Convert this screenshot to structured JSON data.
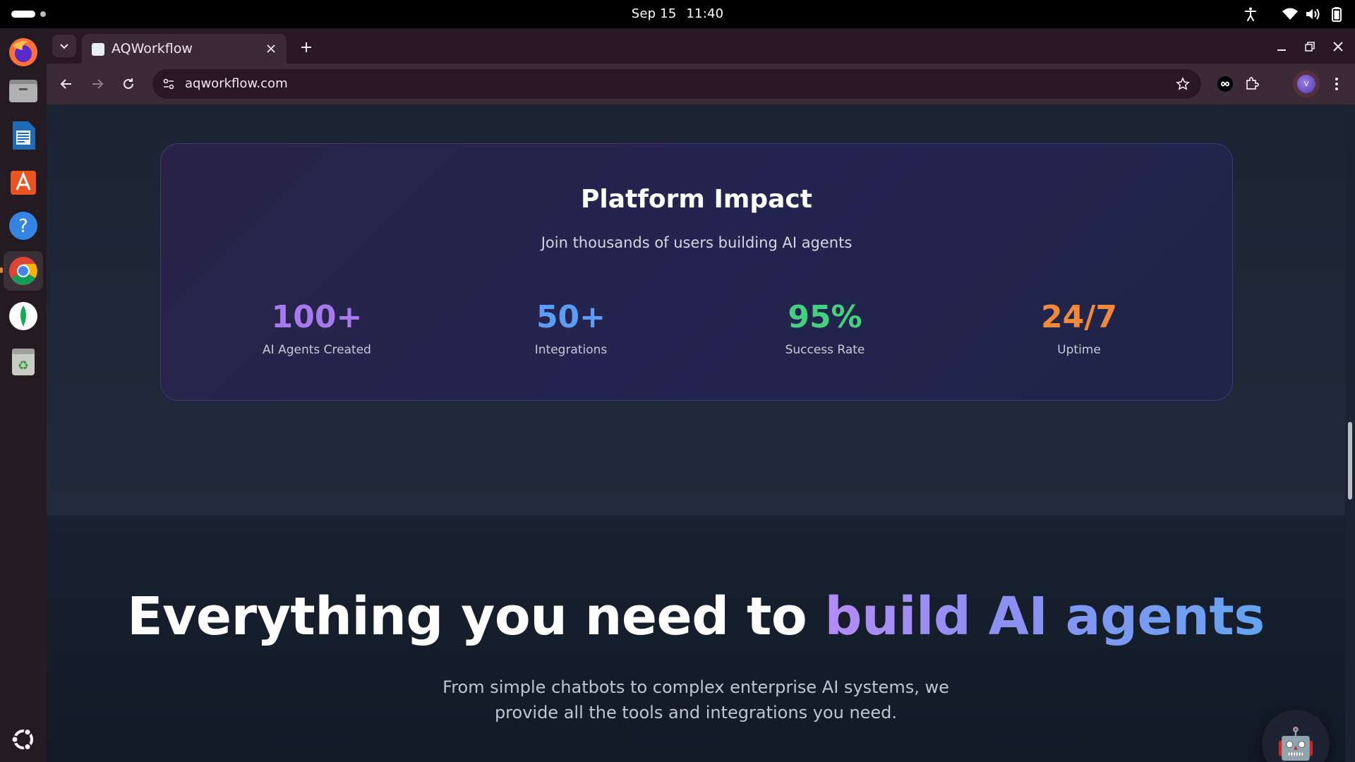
{
  "topbar": {
    "date": "Sep 15",
    "time": "11:40",
    "tray": [
      "accessibility-icon",
      "wifi-icon",
      "volume-icon",
      "battery-icon"
    ]
  },
  "dock": {
    "apps": [
      "firefox",
      "files",
      "libreoffice-writer",
      "app-center",
      "help",
      "chrome",
      "mongodb-compass",
      "trash"
    ],
    "show_apps": "ubuntu-logo"
  },
  "browser": {
    "tab_title": "AQWorkflow",
    "url": "aqworkflow.com"
  },
  "impact": {
    "title": "Platform Impact",
    "subtitle": "Join thousands of users building AI agents",
    "stats": [
      {
        "value": "100+",
        "label": "AI Agents Created",
        "color": "#a779ef"
      },
      {
        "value": "50+",
        "label": "Integrations",
        "color": "#5b9cf4"
      },
      {
        "value": "95%",
        "label": "Success Rate",
        "color": "#44d17e"
      },
      {
        "value": "24/7",
        "label": "Uptime",
        "color": "#f08a3a"
      }
    ]
  },
  "features": {
    "heading_plain": "Everything you need to ",
    "heading_accent": "build AI agents",
    "description": "From simple chatbots to complex enterprise AI systems, we provide all the tools and integrations you need."
  },
  "chat_widget": {
    "icon": "🤖"
  }
}
